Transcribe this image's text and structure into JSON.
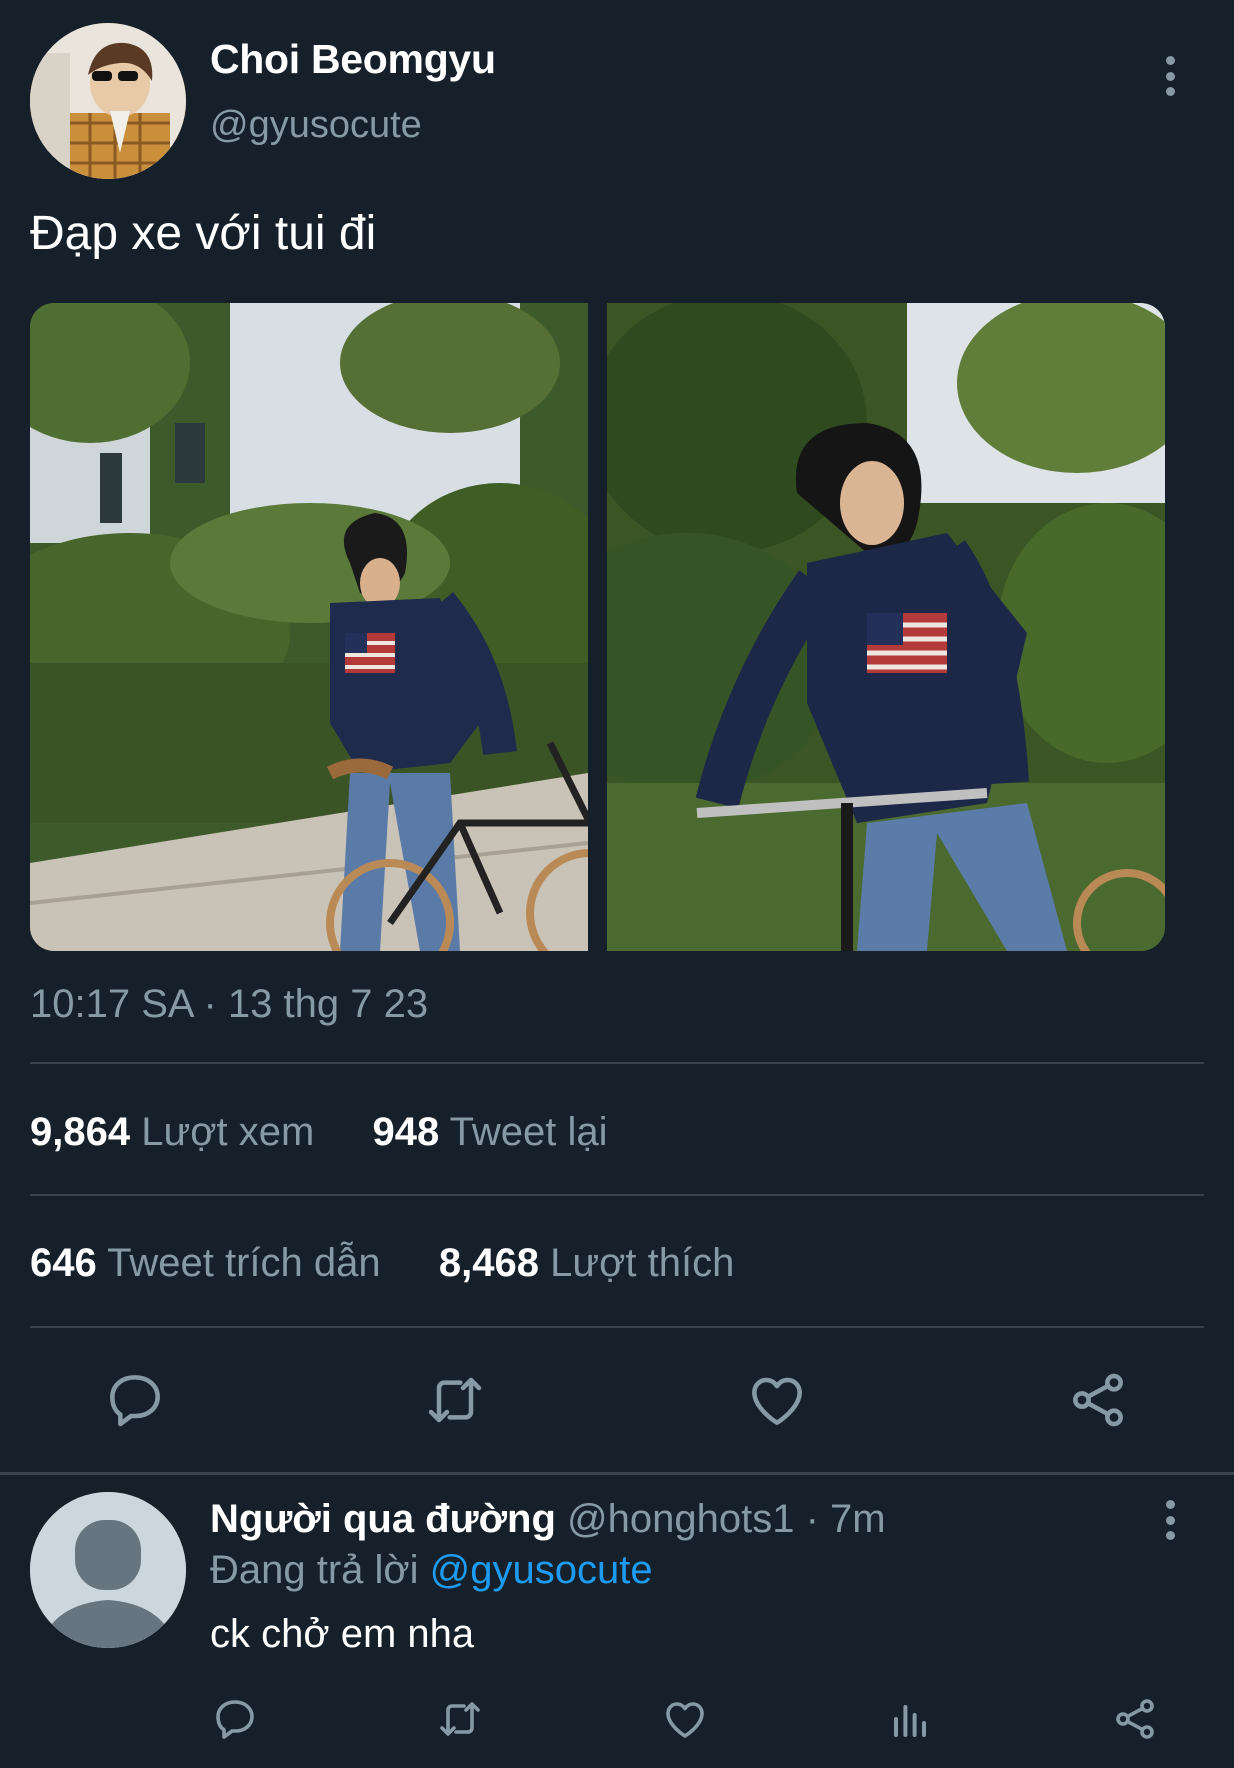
{
  "tweet": {
    "author_name": "Choi Beomgyu",
    "author_handle": "@gyusocute",
    "text": "Đạp xe với tui đi",
    "timestamp": "10:17 SA · 13 thg 7 23",
    "stats": {
      "views_count": "9,864",
      "views_label": "Lượt xem",
      "retweets_count": "948",
      "retweets_label": "Tweet lại",
      "quotes_count": "646",
      "quotes_label": "Tweet trích dẫn",
      "likes_count": "8,468",
      "likes_label": "Lượt thích"
    },
    "action_icons": [
      "reply-icon",
      "retweet-icon",
      "like-icon",
      "share-icon"
    ]
  },
  "reply": {
    "author_name": "Người qua đường",
    "author_handle": "@honghots1",
    "time": "· 7m",
    "replying_label": "Đang trả lời",
    "replying_to": "@gyusocute",
    "text": "ck chở em nha",
    "action_icons": [
      "reply-icon",
      "retweet-icon",
      "like-icon",
      "analytics-icon",
      "share-icon"
    ]
  },
  "colors": {
    "background": "#15202b",
    "muted_text": "#8899a6",
    "link": "#1d9bf0",
    "divider": "#38444d"
  }
}
